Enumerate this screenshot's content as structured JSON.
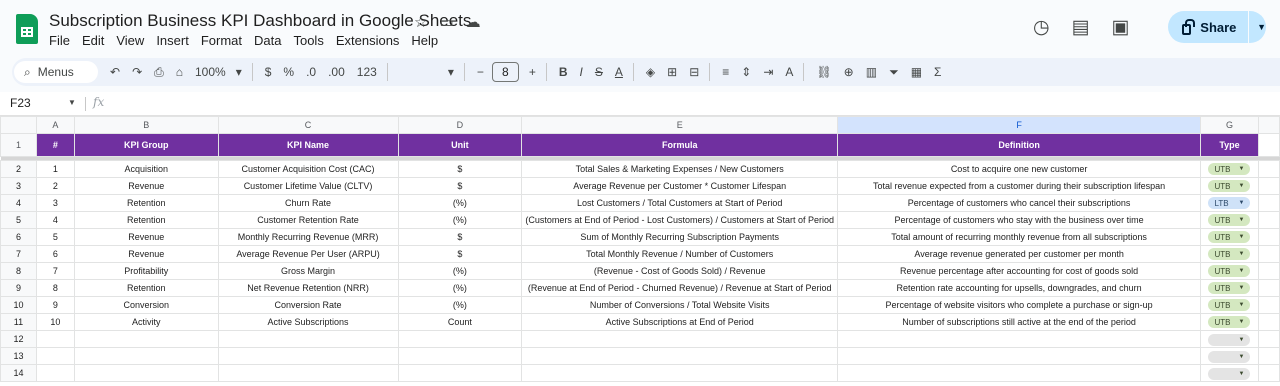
{
  "app": {
    "title": "Subscription Business KPI Dashboard in Google Sheets",
    "menu": [
      "File",
      "Edit",
      "View",
      "Insert",
      "Format",
      "Data",
      "Tools",
      "Extensions",
      "Help"
    ],
    "share_label": "Share"
  },
  "toolbar": {
    "menus_label": "Menus",
    "zoom": "100%",
    "currency": "$",
    "percent": "%",
    "dec_decrease": ".0",
    "dec_increase": ".00",
    "number_format": "123",
    "font_size": "8",
    "bold": "B",
    "italic": "I",
    "strike": "S",
    "text_color": "A",
    "text_color_2": "A"
  },
  "formula_bar": {
    "cell_ref": "F23",
    "fx": "fx"
  },
  "sheet": {
    "columns": [
      "A",
      "B",
      "C",
      "D",
      "E",
      "F",
      "G"
    ],
    "selected_column": "F",
    "header_row": {
      "num": "#",
      "group": "KPI Group",
      "name": "KPI Name",
      "unit": "Unit",
      "formula": "Formula",
      "definition": "Definition",
      "type": "Type"
    },
    "rows": [
      {
        "n": "1",
        "group": "Acquisition",
        "name": "Customer Acquisition Cost (CAC)",
        "unit": "$",
        "formula": "Total Sales & Marketing Expenses / New Customers",
        "definition": "Cost to acquire one new customer",
        "type": "UTB"
      },
      {
        "n": "2",
        "group": "Revenue",
        "name": "Customer Lifetime Value (CLTV)",
        "unit": "$",
        "formula": "Average Revenue per Customer * Customer Lifespan",
        "definition": "Total revenue expected from a customer during their subscription lifespan",
        "type": "UTB"
      },
      {
        "n": "3",
        "group": "Retention",
        "name": "Churn Rate",
        "unit": "(%)",
        "formula": "Lost Customers / Total Customers at Start of Period",
        "definition": "Percentage of customers who cancel their subscriptions",
        "type": "LTB"
      },
      {
        "n": "4",
        "group": "Retention",
        "name": "Customer Retention Rate",
        "unit": "(%)",
        "formula": "(Customers at End of Period - Lost Customers) / Customers at Start of Period",
        "definition": "Percentage of customers who stay with the business over time",
        "type": "UTB"
      },
      {
        "n": "5",
        "group": "Revenue",
        "name": "Monthly Recurring Revenue (MRR)",
        "unit": "$",
        "formula": "Sum of Monthly Recurring Subscription Payments",
        "definition": "Total amount of recurring monthly revenue from all subscriptions",
        "type": "UTB"
      },
      {
        "n": "6",
        "group": "Revenue",
        "name": "Average Revenue Per User (ARPU)",
        "unit": "$",
        "formula": "Total Monthly Revenue / Number of Customers",
        "definition": "Average revenue generated per customer per month",
        "type": "UTB"
      },
      {
        "n": "7",
        "group": "Profitability",
        "name": "Gross Margin",
        "unit": "(%)",
        "formula": "(Revenue - Cost of Goods Sold) / Revenue",
        "definition": "Revenue percentage after accounting for cost of goods sold",
        "type": "UTB"
      },
      {
        "n": "8",
        "group": "Retention",
        "name": "Net Revenue Retention (NRR)",
        "unit": "(%)",
        "formula": "(Revenue at End of Period - Churned Revenue) / Revenue at Start of Period",
        "definition": "Retention rate accounting for upsells, downgrades, and churn",
        "type": "UTB"
      },
      {
        "n": "9",
        "group": "Conversion",
        "name": "Conversion Rate",
        "unit": "(%)",
        "formula": "Number of Conversions / Total Website Visits",
        "definition": "Percentage of website visitors who complete a purchase or sign-up",
        "type": "UTB"
      },
      {
        "n": "10",
        "group": "Activity",
        "name": "Active Subscriptions",
        "unit": "Count",
        "formula": "Active Subscriptions at End of Period",
        "definition": "Number of subscriptions still active at the end of the period",
        "type": "UTB"
      }
    ],
    "row_numbers": [
      "1",
      "2",
      "3",
      "4",
      "5",
      "6",
      "7",
      "8",
      "9",
      "10",
      "11",
      "12",
      "13",
      "14"
    ]
  }
}
